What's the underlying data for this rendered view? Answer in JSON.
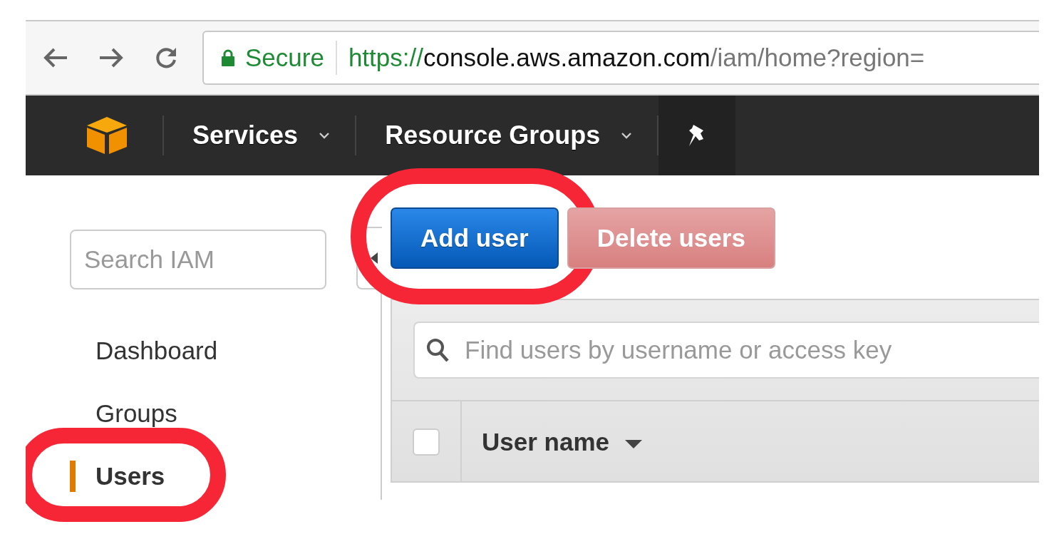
{
  "browser": {
    "security_label": "Secure",
    "url_scheme": "https://",
    "url_host": "console.aws.amazon.com",
    "url_path": "/iam/home?region="
  },
  "navbar": {
    "menus": [
      {
        "label": "Services"
      },
      {
        "label": "Resource Groups"
      }
    ]
  },
  "sidebar": {
    "search": {
      "placeholder": "Search IAM"
    },
    "items": [
      {
        "label": "Dashboard",
        "selected": false,
        "circled": false
      },
      {
        "label": "Groups",
        "selected": false,
        "circled": false
      },
      {
        "label": "Users",
        "selected": true,
        "circled": true
      }
    ]
  },
  "toolbar": {
    "buttons": [
      {
        "label": "Add user",
        "kind": "primary",
        "disabled": false,
        "circled": true
      },
      {
        "label": "Delete users",
        "kind": "danger",
        "disabled": true,
        "circled": false
      }
    ]
  },
  "users_table": {
    "search": {
      "placeholder": "Find users by username or access key"
    },
    "select_all": {
      "checked": false
    },
    "columns": [
      {
        "label": "User name",
        "sorted": true
      }
    ]
  }
}
